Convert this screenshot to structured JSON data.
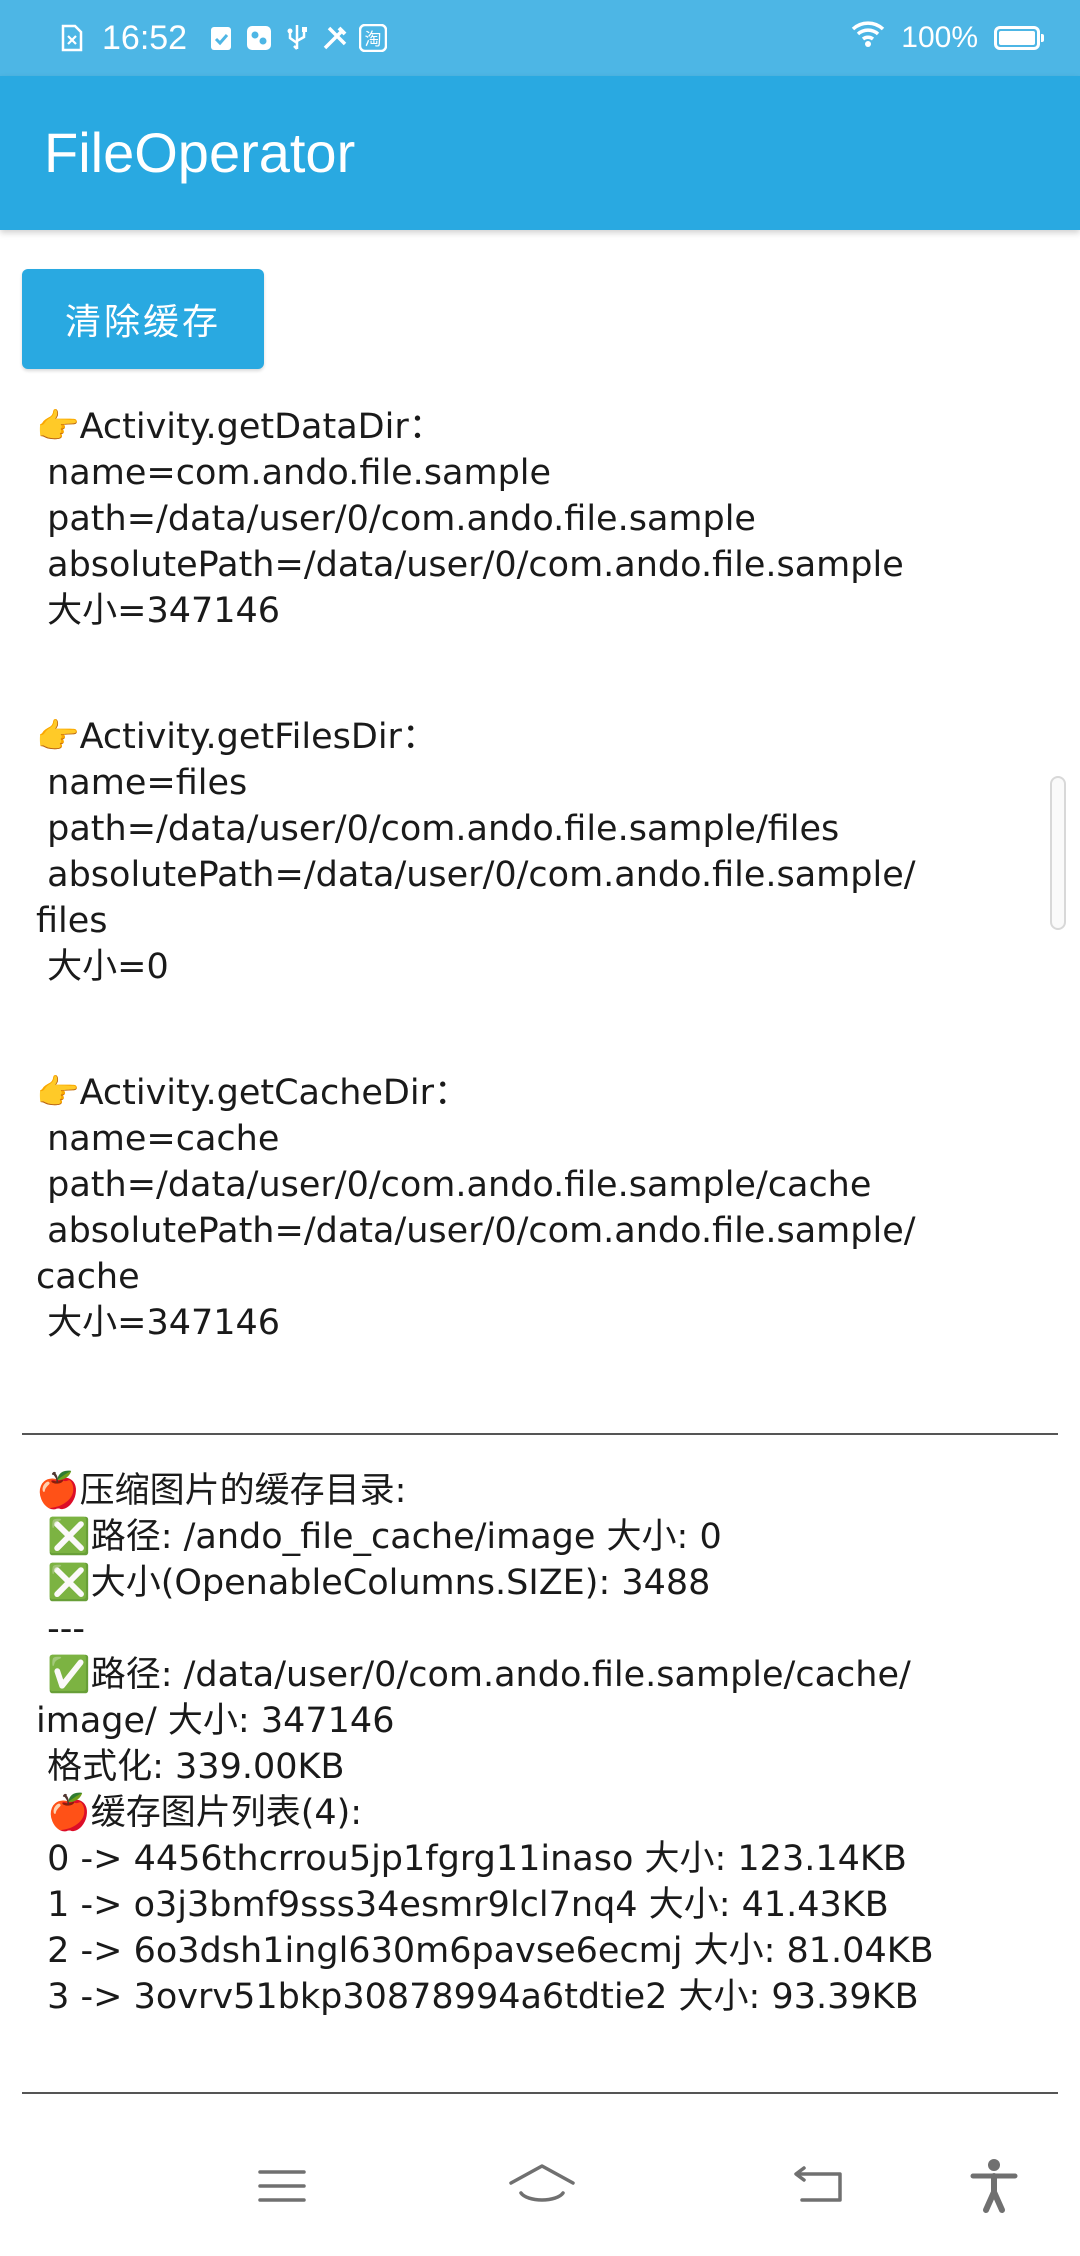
{
  "status_bar": {
    "time": "16:52",
    "battery_percent": "100%",
    "battery_level": 1.0,
    "left_icons": [
      "sim-icon",
      "check-clipboard-icon",
      "app-icon",
      "usb-icon",
      "tools-icon",
      "taobao-icon"
    ],
    "taobao_glyph": "淘",
    "right_icons": [
      "wifi-icon",
      "battery-icon"
    ]
  },
  "app_bar": {
    "title": "FileOperator",
    "color": "#29a9e1"
  },
  "main": {
    "clear_cache_button": "清除缓存",
    "data_dir": {
      "heading": "👉Activity.getDataDir：",
      "name": " name=com.ando.file.sample",
      "path": " path=/data/user/0/com.ando.file.sample",
      "absolute_path": " absolutePath=/data/user/0/com.ando.file.sample",
      "size": " 大小=347146"
    },
    "files_dir": {
      "heading": "👉Activity.getFilesDir：",
      "name": " name=files",
      "path": " path=/data/user/0/com.ando.file.sample/files",
      "absolute_path_line1": " absolutePath=/data/user/0/com.ando.file.sample/",
      "absolute_path_line2": "files",
      "size": " 大小=0"
    },
    "cache_dir": {
      "heading": "👉Activity.getCacheDir：",
      "name": " name=cache",
      "path": " path=/data/user/0/com.ando.file.sample/cache",
      "absolute_path_line1": " absolutePath=/data/user/0/com.ando.file.sample/",
      "absolute_path_line2": "cache",
      "size": " 大小=347146"
    },
    "compressed_cache": {
      "heading": "🍎压缩图片的缓存目录:",
      "rel_path": " ❎路径: /ando_file_cache/image 大小: 0",
      "openable_size": " ❎大小(OpenableColumns.SIZE): 3488",
      "separator": " ---",
      "abs_path_line1": " ✅路径: /data/user/0/com.ando.file.sample/cache/",
      "abs_path_line2": "image/ 大小: 347146",
      "formatted": " 格式化: 339.00KB",
      "list_heading": " 🍎缓存图片列表(4):",
      "items": [
        " 0 -> 4456thcrrou5jp1fgrg11inaso 大小: 123.14KB",
        " 1 -> o3j3bmf9sss34esmr9lcl7nq4 大小: 41.43KB",
        " 2 -> 6o3dsh1ingl630m6pavse6ecmj 大小: 81.04KB",
        " 3 -> 3ovrv51bkp30878994a6tdtie2 大小: 93.39KB"
      ]
    }
  },
  "nav_bar": {
    "icons": [
      "menu-icon",
      "home-icon",
      "back-icon",
      "accessibility-icon"
    ]
  }
}
